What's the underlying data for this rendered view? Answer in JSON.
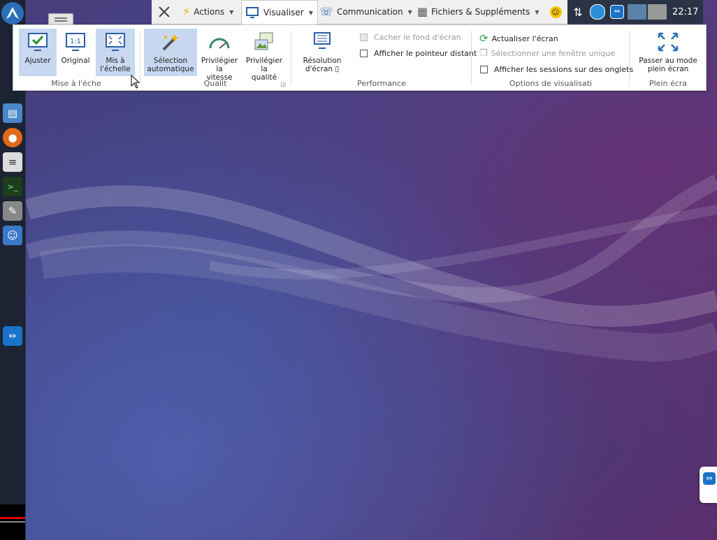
{
  "tabs": [
    {
      "label": "Actions",
      "icon": "lightning-icon"
    },
    {
      "label": "Visualiser",
      "icon": "monitor-icon",
      "active": true
    },
    {
      "label": "Communication",
      "icon": "phone-icon"
    },
    {
      "label": "Fichiers & Suppléments",
      "icon": "files-icon"
    }
  ],
  "tray": {
    "clock": "22:17"
  },
  "ribbon": {
    "groups": {
      "scale": {
        "label": "Mise à l'éche",
        "buttons": [
          {
            "label_lines": [
              "Ajuster"
            ],
            "selected": true
          },
          {
            "label_lines": [
              "Original"
            ],
            "selected": false
          },
          {
            "label_lines": [
              "Mis à",
              "l'échelle"
            ],
            "selected": true
          }
        ]
      },
      "quality": {
        "label": "Qualit",
        "buttons": [
          {
            "label_lines": [
              "Sélection",
              "automatique"
            ],
            "selected": true
          },
          {
            "label_lines": [
              "Privilégier la",
              "vitesse"
            ],
            "selected": false
          },
          {
            "label_lines": [
              "Privilégier la",
              "qualité"
            ],
            "selected": false
          }
        ]
      },
      "performance": {
        "label": "Performance",
        "resolution_lines": [
          "Résolution",
          "d'écran ▯"
        ],
        "checkboxes": [
          {
            "label": "Cacher le fond d'écran",
            "enabled": false
          },
          {
            "label": "Afficher le pointeur distant",
            "enabled": true
          }
        ]
      },
      "view": {
        "label": "Options de visualisati",
        "refresh": "Actualiser l'écran",
        "select_window": "Sélectionner une fenêtre unique",
        "tabs_option": "Afficher les sessions sur des onglets"
      },
      "fullscreen": {
        "label": "Plein écra",
        "button_lines": [
          "Passer au mode",
          "plein écran"
        ]
      }
    }
  },
  "colors": {
    "accent": "#1a73c8",
    "selected": "#c7d8f0",
    "panel": "#1c2433"
  }
}
